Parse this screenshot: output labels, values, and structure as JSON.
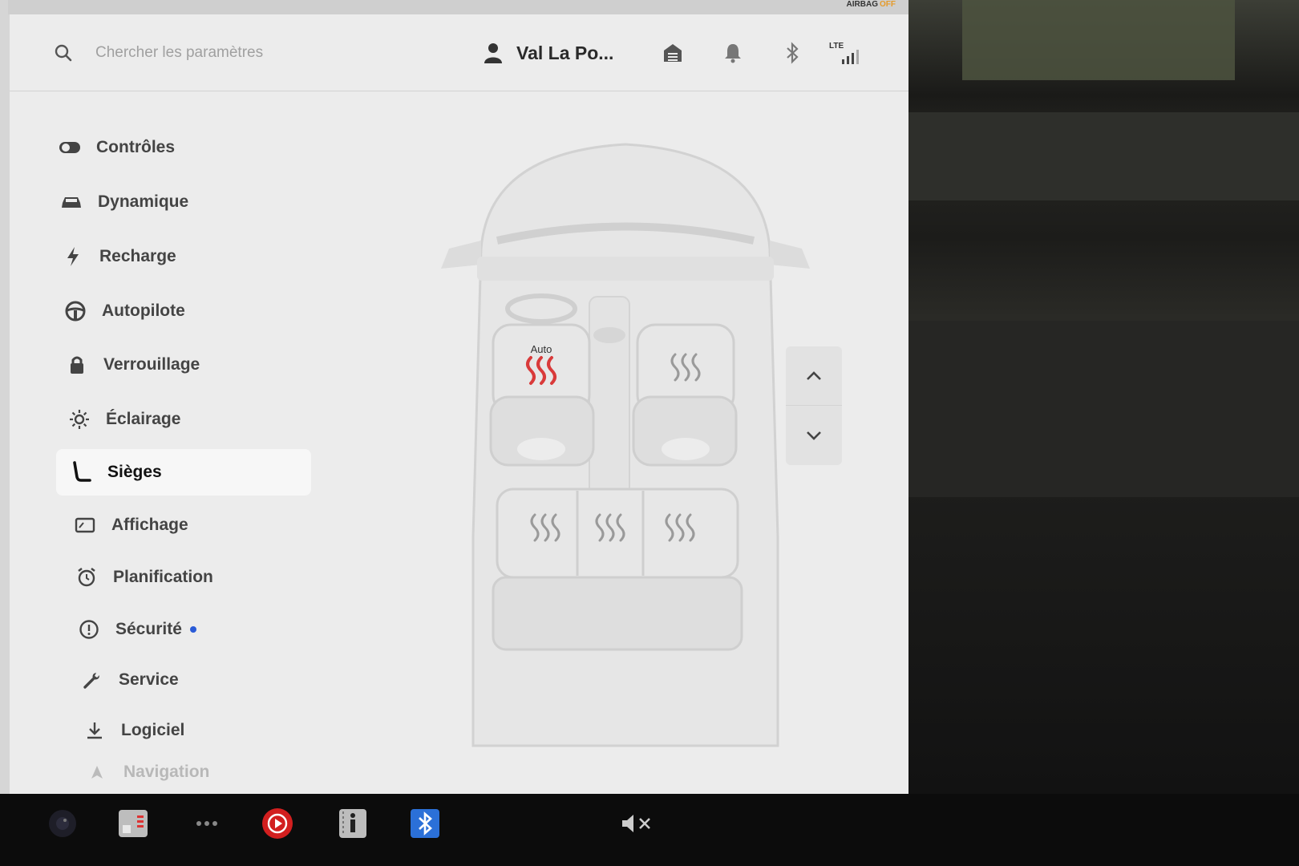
{
  "status": {
    "airbag_label": "AIRBAG",
    "airbag_state": "OFF"
  },
  "header": {
    "search_placeholder": "Chercher les paramètres",
    "profile_name": "Val La Po...",
    "network_label": "LTE"
  },
  "sidebar": {
    "active_item": "Sièges",
    "items": [
      {
        "label": "Contrôles",
        "icon": "toggle-icon"
      },
      {
        "label": "Dynamique",
        "icon": "car-icon"
      },
      {
        "label": "Recharge",
        "icon": "bolt-icon"
      },
      {
        "label": "Autopilote",
        "icon": "steering-wheel-icon"
      },
      {
        "label": "Verrouillage",
        "icon": "lock-icon"
      },
      {
        "label": "Éclairage",
        "icon": "light-icon"
      },
      {
        "label": "Sièges",
        "icon": "seat-icon"
      },
      {
        "label": "Affichage",
        "icon": "display-icon"
      },
      {
        "label": "Planification",
        "icon": "alarm-clock-icon"
      },
      {
        "label": "Sécurité",
        "icon": "info-circle-icon",
        "badge": true
      },
      {
        "label": "Service",
        "icon": "wrench-icon"
      },
      {
        "label": "Logiciel",
        "icon": "download-icon"
      },
      {
        "label": "Navigation",
        "icon": "navigation-icon"
      }
    ]
  },
  "seats": {
    "driver_mode": "Auto",
    "driver_heat_color": "#d93a3a",
    "inactive_heat_color": "#9a9a9a"
  },
  "taskbar": {
    "apps": [
      "camera-icon",
      "energy-icon",
      "more-icon",
      "youtube-icon",
      "manual-icon",
      "bluetooth-icon"
    ],
    "volume_state": "muted"
  },
  "colors": {
    "accent_dot": "#2a5bd7",
    "bluetooth_tile": "#2b70d8",
    "youtube": "#d21f1f"
  }
}
